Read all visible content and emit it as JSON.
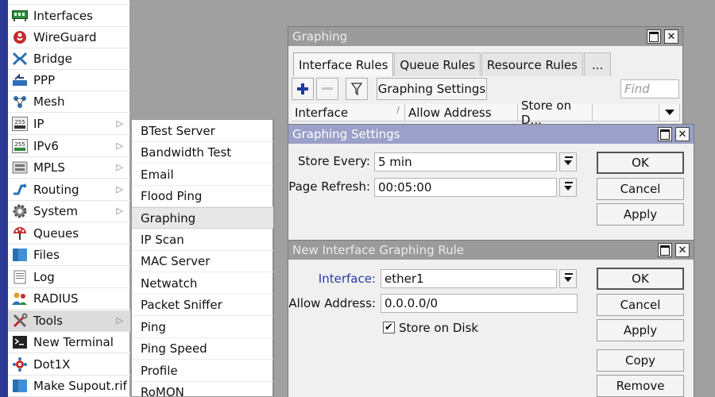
{
  "main_menu": {
    "items": [
      {
        "label": "Interfaces"
      },
      {
        "label": "WireGuard"
      },
      {
        "label": "Bridge"
      },
      {
        "label": "PPP"
      },
      {
        "label": "Mesh"
      },
      {
        "label": "IP"
      },
      {
        "label": "IPv6"
      },
      {
        "label": "MPLS"
      },
      {
        "label": "Routing"
      },
      {
        "label": "System"
      },
      {
        "label": "Queues"
      },
      {
        "label": "Files"
      },
      {
        "label": "Log"
      },
      {
        "label": "RADIUS"
      },
      {
        "label": "Tools"
      },
      {
        "label": "New Terminal"
      },
      {
        "label": "Dot1X"
      },
      {
        "label": "Make Supout.rif"
      }
    ],
    "ip_icon_text": "255",
    "ipv6_icon_text": "255"
  },
  "submenu": {
    "items": [
      {
        "label": "BTest Server"
      },
      {
        "label": "Bandwidth Test"
      },
      {
        "label": "Email"
      },
      {
        "label": "Flood Ping"
      },
      {
        "label": "Graphing"
      },
      {
        "label": "IP Scan"
      },
      {
        "label": "MAC Server"
      },
      {
        "label": "Netwatch"
      },
      {
        "label": "Packet Sniffer"
      },
      {
        "label": "Ping"
      },
      {
        "label": "Ping Speed"
      },
      {
        "label": "Profile"
      },
      {
        "label": "RoMON"
      }
    ]
  },
  "graphing_window": {
    "title": "Graphing",
    "tabs": [
      "Interface Rules",
      "Queue Rules",
      "Resource Rules",
      "..."
    ],
    "settings_button": "Graphing Settings",
    "find_placeholder": "Find",
    "columns": [
      "Interface",
      "Allow Address",
      "Store on D..."
    ]
  },
  "settings_dialog": {
    "title": "Graphing Settings",
    "store_every_label": "Store Every:",
    "store_every_value": "5 min",
    "page_refresh_label": "Page Refresh:",
    "page_refresh_value": "00:05:00",
    "ok": "OK",
    "cancel": "Cancel",
    "apply": "Apply"
  },
  "rule_dialog": {
    "title": "New Interface Graphing Rule",
    "interface_label": "Interface:",
    "interface_value": "ether1",
    "allow_label": "Allow Address:",
    "allow_value": "0.0.0.0/0",
    "store_label": "Store on Disk",
    "store_checked": true,
    "ok": "OK",
    "cancel": "Cancel",
    "apply": "Apply",
    "copy": "Copy",
    "remove": "Remove"
  },
  "colors": {
    "active_title": "#9aa0c8",
    "inactive_title": "#9b9b9b",
    "nav_strip": "#2c3a96",
    "link_blue": "#2a3aa8"
  }
}
